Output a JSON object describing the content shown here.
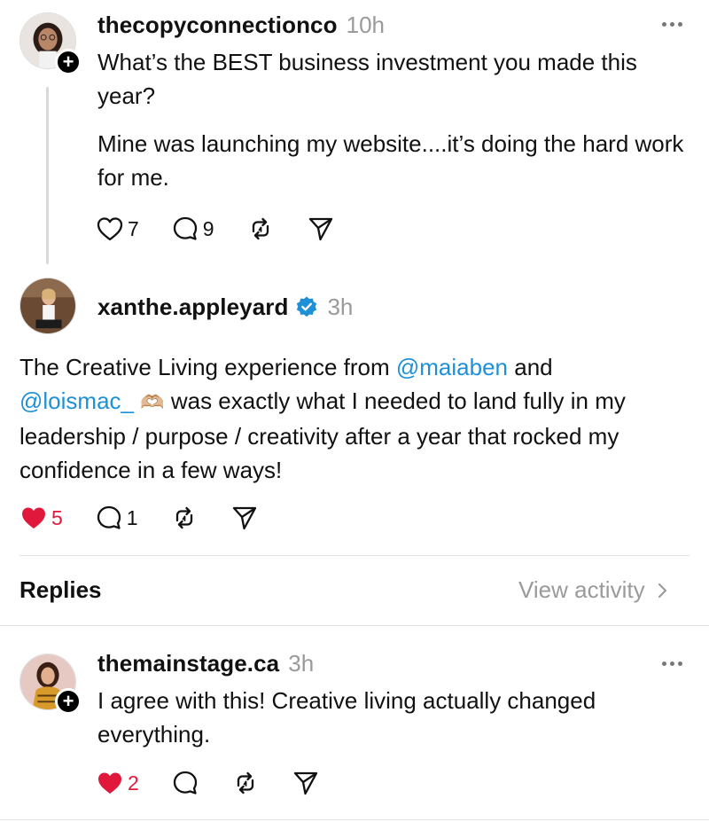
{
  "posts": [
    {
      "username": "thecopyconnectionco",
      "time": "10h",
      "paragraphs": [
        "What’s the BEST business investment you made this year?",
        "Mine was launching my website....it’s doing the hard work for me."
      ],
      "likes": "7",
      "comments": "9",
      "liked": false
    },
    {
      "username": "xanthe.appleyard",
      "verified": true,
      "time": "3h",
      "text_a": "The Creative Living experience from ",
      "mention_1": "@maiaben",
      "text_b": " and",
      "mention_2": "@loismac_",
      "emoji": "🫶🏼",
      "text_c": " was exactly what I needed to land fully in my leadership / purpose / creativity after a year that rocked my confidence in a few ways!",
      "likes": "5",
      "comments": "1",
      "liked": true
    }
  ],
  "replies_header": {
    "title": "Replies",
    "view_activity": "View activity"
  },
  "reply": {
    "username": "themainstage.ca",
    "time": "3h",
    "text": "I agree with this! Creative living actually changed everything.",
    "likes": "2",
    "liked": true
  },
  "colors": {
    "accent_link": "#1e90d8",
    "like_red": "#e0193c",
    "muted": "#9a9a9a"
  },
  "icons": [
    "heart-icon",
    "comment-icon",
    "repost-icon",
    "share-icon",
    "more-icon",
    "plus-icon",
    "verified-icon",
    "chevron-right-icon"
  ]
}
